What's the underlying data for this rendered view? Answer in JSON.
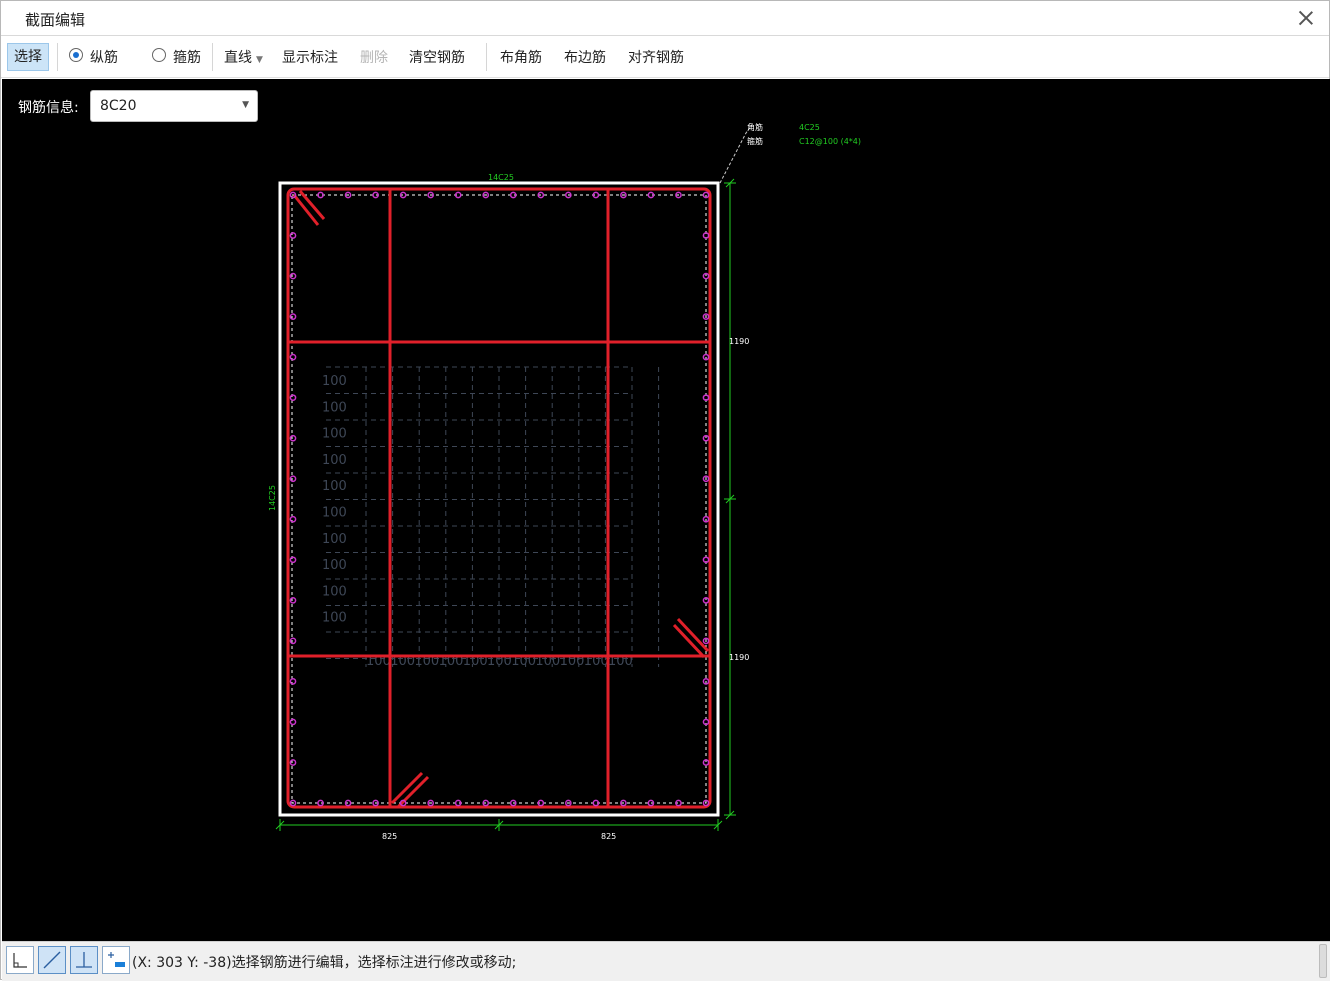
{
  "window": {
    "title": "截面编辑"
  },
  "toolbar": {
    "select": "选择",
    "longitudinal": "纵筋",
    "stirrup": "箍筋",
    "line": "直线",
    "show_dims": "显示标注",
    "delete": "删除",
    "clear": "清空钢筋",
    "corner": "布角筋",
    "edge": "布边筋",
    "align": "对齐钢筋"
  },
  "rebar_info": {
    "label": "钢筋信息:",
    "value": "8C20"
  },
  "drawing": {
    "top_dim": "14C25",
    "left_dim": "14C25",
    "leader_label_1": "角筋",
    "leader_label_2": "箍筋",
    "leader_value_1": "4C25",
    "leader_value_2": "C12@100 (4*4)",
    "dim_right_top": "1190",
    "dim_right_bottom": "1190",
    "dim_bottom_left": "825",
    "dim_bottom_right": "825",
    "grid_row_labels": [
      "100",
      "100",
      "100",
      "100",
      "100",
      "100",
      "100",
      "100",
      "100",
      "100"
    ],
    "grid_col_labels": [
      "100",
      "100",
      "100",
      "100",
      "100",
      "100",
      "100",
      "100",
      "100",
      "100",
      "100"
    ],
    "colors": {
      "rebar": "#e0202a",
      "dim": "#22cc22",
      "dot": "#cc33cc",
      "outline": "#ffffff"
    }
  },
  "status": {
    "text": "(X: 303 Y: -38)选择钢筋进行编辑，选择标注进行修改或移动;"
  }
}
